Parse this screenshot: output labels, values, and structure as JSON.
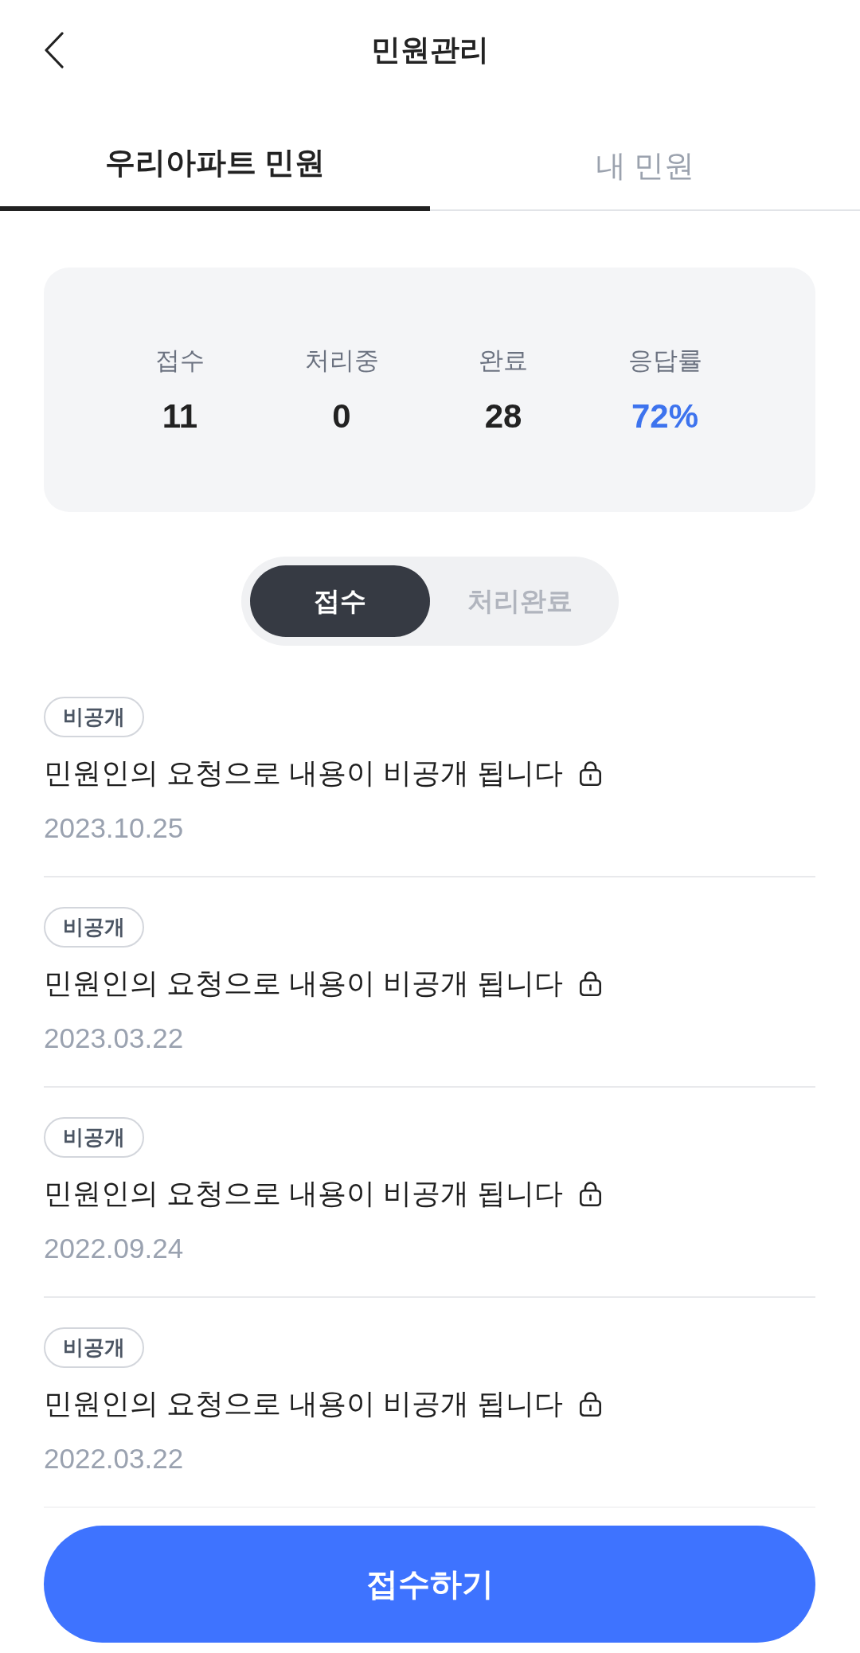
{
  "header": {
    "title": "민원관리"
  },
  "tabs": [
    {
      "label": "우리아파트 민원",
      "selected": true
    },
    {
      "label": "내 민원",
      "selected": false
    }
  ],
  "stats": [
    {
      "label": "접수",
      "value": "11",
      "kind": "count"
    },
    {
      "label": "처리중",
      "value": "0",
      "kind": "count"
    },
    {
      "label": "완료",
      "value": "28",
      "kind": "count"
    },
    {
      "label": "응답률",
      "value": "72%",
      "kind": "rate"
    }
  ],
  "filter": [
    {
      "label": "접수",
      "selected": true
    },
    {
      "label": "처리완료",
      "selected": false
    }
  ],
  "complaints": [
    {
      "tag": "비공개",
      "title": "민원인의 요청으로 내용이 비공개 됩니다",
      "locked": true,
      "date": "2023.10.25"
    },
    {
      "tag": "비공개",
      "title": "민원인의 요청으로 내용이 비공개 됩니다",
      "locked": true,
      "date": "2023.03.22"
    },
    {
      "tag": "비공개",
      "title": "민원인의 요청으로 내용이 비공개 됩니다",
      "locked": true,
      "date": "2022.09.24"
    },
    {
      "tag": "비공개",
      "title": "민원인의 요청으로 내용이 비공개 됩니다",
      "locked": true,
      "date": "2022.03.22"
    }
  ],
  "submit_button": {
    "label": "접수하기"
  }
}
